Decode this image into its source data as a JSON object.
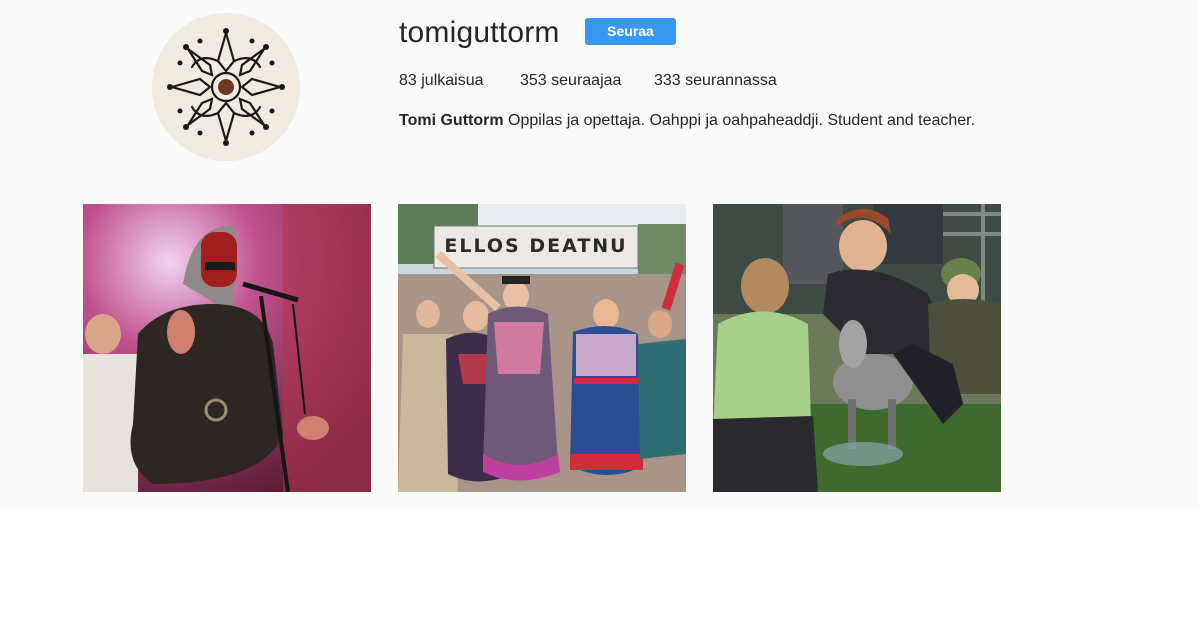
{
  "profile": {
    "username": "tomiguttorm",
    "follow_label": "Seuraa",
    "stats": [
      {
        "count": "83",
        "label": "julkaisua"
      },
      {
        "count": "353",
        "label": "seuraajaa"
      },
      {
        "count": "333",
        "label": "seurannassa"
      }
    ],
    "bio": {
      "name": "Tomi Guttorm",
      "text": "Oppilas ja opettaja. Oahppi ja oahpaheaddji. Student and teacher."
    },
    "accent_color": "#3897f0"
  },
  "posts": [
    {
      "description": "singer-on-stage-photo"
    },
    {
      "description": "festival-crowd-photo",
      "banner_text": "ELLOS DEATNU"
    },
    {
      "description": "reindeer-and-people-photo"
    }
  ]
}
